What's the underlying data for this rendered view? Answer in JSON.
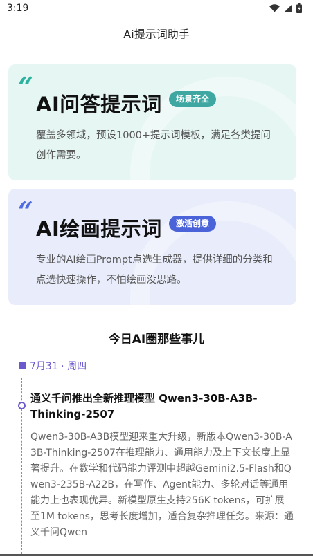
{
  "status_bar": {
    "time": "3:19",
    "icons": [
      "wifi-icon",
      "cell-signal-icon",
      "battery-icon"
    ]
  },
  "header": {
    "title": "Ai提示词助手"
  },
  "cards": {
    "qa": {
      "title": "AI问答提示词",
      "badge": "场景齐全",
      "description": "覆盖多领域，预设1000+提示词模板，满足各类提问创作需要。",
      "accent": "#2bb3a0",
      "background": "#e6f6f3"
    },
    "draw": {
      "title": "AI绘画提示词",
      "badge": "激活创意",
      "description": "专业的AI绘画Prompt点选生成器，提供详细的分类和点选快速操作，不怕绘画没思路。",
      "accent": "#4f6de0",
      "background": "#e9edfb"
    }
  },
  "news_section": {
    "title": "今日AI圈那些事儿",
    "date": "7月31 · 周四",
    "items": [
      {
        "title": "通义千问推出全新推理模型 Qwen3-30B-A3B-Thinking-2507",
        "body": "Qwen3-30B-A3B模型迎来重大升级，新版本Qwen3-30B-A3B-Thinking-2507在推理能力、通用能力及上下文长度上显著提升。在数学和代码能力评测中超越Gemini2.5-Flash和Qwen3-235B-A22B，在写作、Agent能力、多轮对话等通用能力上也表现优异。新模型原生支持256K tokens，可扩展至1M tokens，思考长度增加，适合复杂推理任务。来源：通义千问Qwen"
      }
    ]
  },
  "colors": {
    "timeline_accent": "#6a5acd"
  }
}
